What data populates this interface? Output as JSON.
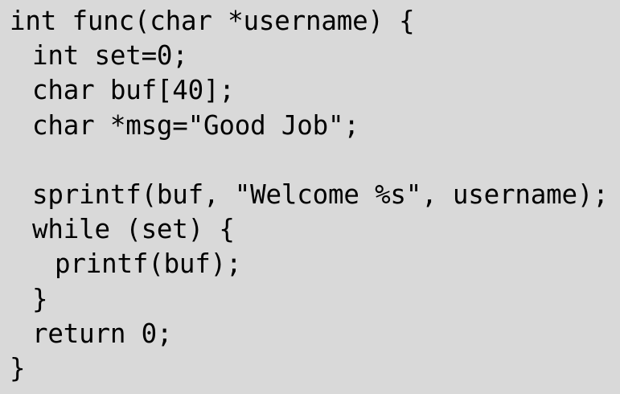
{
  "code": {
    "lines": [
      {
        "text": "int func(char *username) {",
        "indent": 0
      },
      {
        "text": "int set=0;",
        "indent": 1
      },
      {
        "text": "char buf[40];",
        "indent": 1
      },
      {
        "text": "char *msg=\"Good Job\";",
        "indent": 1
      },
      {
        "text": "",
        "indent": 0
      },
      {
        "text": "sprintf(buf, \"Welcome %s\", username);",
        "indent": 1
      },
      {
        "text": "while (set) {",
        "indent": 1
      },
      {
        "text": "printf(buf);",
        "indent": 2
      },
      {
        "text": "}",
        "indent": 1
      },
      {
        "text": "return 0;",
        "indent": 1
      },
      {
        "text": "}",
        "indent": 0
      }
    ]
  }
}
